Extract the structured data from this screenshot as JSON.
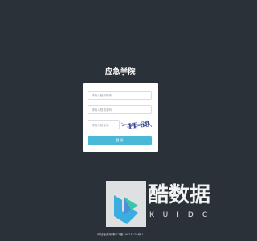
{
  "app": {
    "title": "应急学院"
  },
  "login_form": {
    "account_placeholder": "请输入登录账号",
    "password_placeholder": "请输入登录密码",
    "captcha_placeholder": "请输入验证码",
    "captcha_text": "4T 68",
    "submit_label": "登 录"
  },
  "watermark": {
    "name": "酷数据",
    "latin": "KUIDC"
  },
  "footer": {
    "icp": "网站备案号:黔ICP备19025129号-1"
  },
  "colors": {
    "background": "#2b3138",
    "button": "#4ab9d8",
    "captcha": "#3a4a9a"
  }
}
